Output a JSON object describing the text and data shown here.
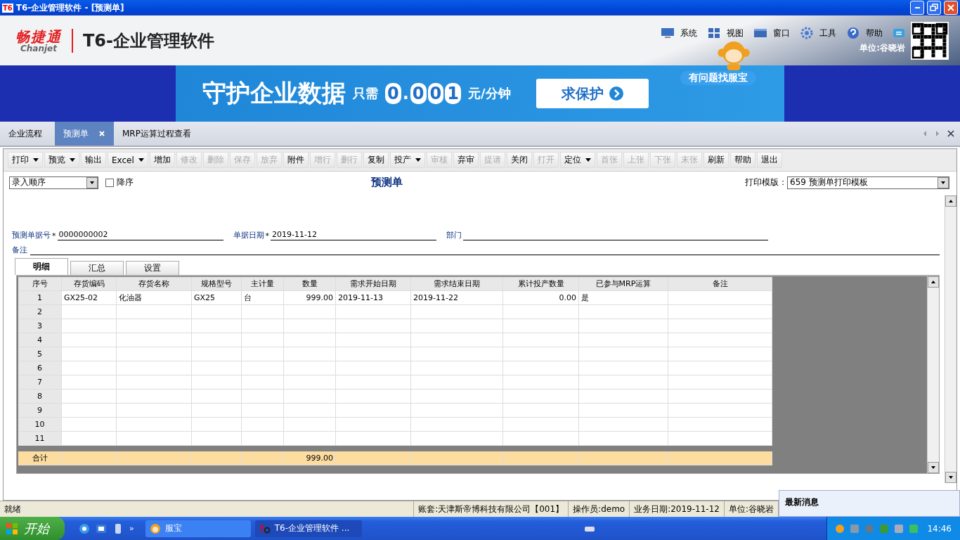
{
  "window": {
    "title": "T6-企业管理软件 - [预测单]",
    "app_badge": "T6"
  },
  "header": {
    "brand": "畅捷通",
    "brand_sub": "Chanjet",
    "product": "T6-企业管理软件",
    "menu": [
      "系统",
      "视图",
      "窗口",
      "工具",
      "帮助"
    ],
    "unit": "单位:谷晓岩"
  },
  "banner": {
    "headline": "守护企业数据",
    "prefix": "只需",
    "digits": [
      "0",
      ".",
      "0",
      "0",
      "1"
    ],
    "suffix": "元/分钟",
    "button": "求保护",
    "bubble": "有问题找服宝"
  },
  "tabs": [
    {
      "label": "企业流程",
      "selected": false,
      "closable": false
    },
    {
      "label": "预测单",
      "selected": true,
      "closable": true
    },
    {
      "label": "MRP运算过程查看",
      "selected": false,
      "closable": false
    }
  ],
  "toolbar": [
    {
      "label": "打印",
      "disabled": false,
      "dropdown": true
    },
    {
      "label": "预览",
      "disabled": false,
      "dropdown": true
    },
    {
      "label": "输出",
      "disabled": false,
      "dropdown": false
    },
    {
      "label": "Excel",
      "disabled": false,
      "dropdown": true
    },
    {
      "label": "增加",
      "disabled": false,
      "dropdown": false
    },
    {
      "label": "修改",
      "disabled": true,
      "dropdown": false
    },
    {
      "label": "删除",
      "disabled": true,
      "dropdown": false
    },
    {
      "label": "保存",
      "disabled": true,
      "dropdown": false
    },
    {
      "label": "放弃",
      "disabled": true,
      "dropdown": false
    },
    {
      "label": "附件",
      "disabled": false,
      "dropdown": false
    },
    {
      "label": "增行",
      "disabled": true,
      "dropdown": false
    },
    {
      "label": "删行",
      "disabled": true,
      "dropdown": false
    },
    {
      "label": "复制",
      "disabled": false,
      "dropdown": false
    },
    {
      "label": "投产",
      "disabled": false,
      "dropdown": true
    },
    {
      "label": "审核",
      "disabled": true,
      "dropdown": false
    },
    {
      "label": "弃审",
      "disabled": false,
      "dropdown": false
    },
    {
      "label": "提请",
      "disabled": true,
      "dropdown": false
    },
    {
      "label": "关闭",
      "disabled": false,
      "dropdown": false
    },
    {
      "label": "打开",
      "disabled": true,
      "dropdown": false
    },
    {
      "label": "定位",
      "disabled": false,
      "dropdown": true
    },
    {
      "label": "首张",
      "disabled": true,
      "dropdown": false
    },
    {
      "label": "上张",
      "disabled": true,
      "dropdown": false
    },
    {
      "label": "下张",
      "disabled": true,
      "dropdown": false
    },
    {
      "label": "末张",
      "disabled": true,
      "dropdown": false
    },
    {
      "label": "刷新",
      "disabled": false,
      "dropdown": false
    },
    {
      "label": "帮助",
      "disabled": false,
      "dropdown": false
    },
    {
      "label": "退出",
      "disabled": false,
      "dropdown": false
    }
  ],
  "form": {
    "sort": "录入顺序",
    "descending": {
      "label": "降序",
      "checked": false
    },
    "title": "预测单",
    "template_label": "打印模版：",
    "template": "659 预测单打印模板",
    "fields": [
      {
        "label": "预测单据号",
        "marker": "*",
        "value": "0000000002"
      },
      {
        "label": "单据日期",
        "marker": "*",
        "value": "2019-11-12"
      },
      {
        "label": "部门"
      }
    ],
    "remark": {
      "label": "备注"
    }
  },
  "subtabs": [
    {
      "label": "明细",
      "selected": true
    },
    {
      "label": "汇总",
      "selected": false
    },
    {
      "label": "设置",
      "selected": false
    }
  ],
  "table": {
    "columns": [
      "序号",
      "存货编码",
      "存货名称",
      "规格型号",
      "主计量",
      "数量",
      "需求开始日期",
      "需求结束日期",
      "累计投产数量",
      "已参与MRP运算",
      "备注"
    ],
    "rows": [
      [
        "1",
        "GX25-02",
        "化油器",
        "GX25",
        "台",
        "999.00",
        "2019-11-13",
        "2019-11-22",
        "0.00",
        "是",
        ""
      ],
      [
        "2"
      ],
      [
        "3"
      ],
      [
        "4"
      ],
      [
        "5"
      ],
      [
        "6"
      ],
      [
        "7"
      ],
      [
        "8"
      ],
      [
        "9"
      ],
      [
        "10"
      ],
      [
        "11"
      ]
    ],
    "total": {
      "label": "合计",
      "quantity": "999.00"
    }
  },
  "status_bar": [
    "就绪",
    "账套:天津斯帝博科技有限公司【001】",
    "操作员:demo",
    "业务日期:2019-11-12",
    "单位:谷晓岩"
  ],
  "news": {
    "title": "最新消息"
  },
  "taskbar": {
    "start": "开始",
    "tasks": [
      {
        "label": "服宝",
        "selected": false,
        "kind": "mascot"
      },
      {
        "label": "T6-企业管理软件 ...",
        "selected": true,
        "kind": "t6"
      }
    ],
    "clock": "14:46",
    "more": "»"
  }
}
